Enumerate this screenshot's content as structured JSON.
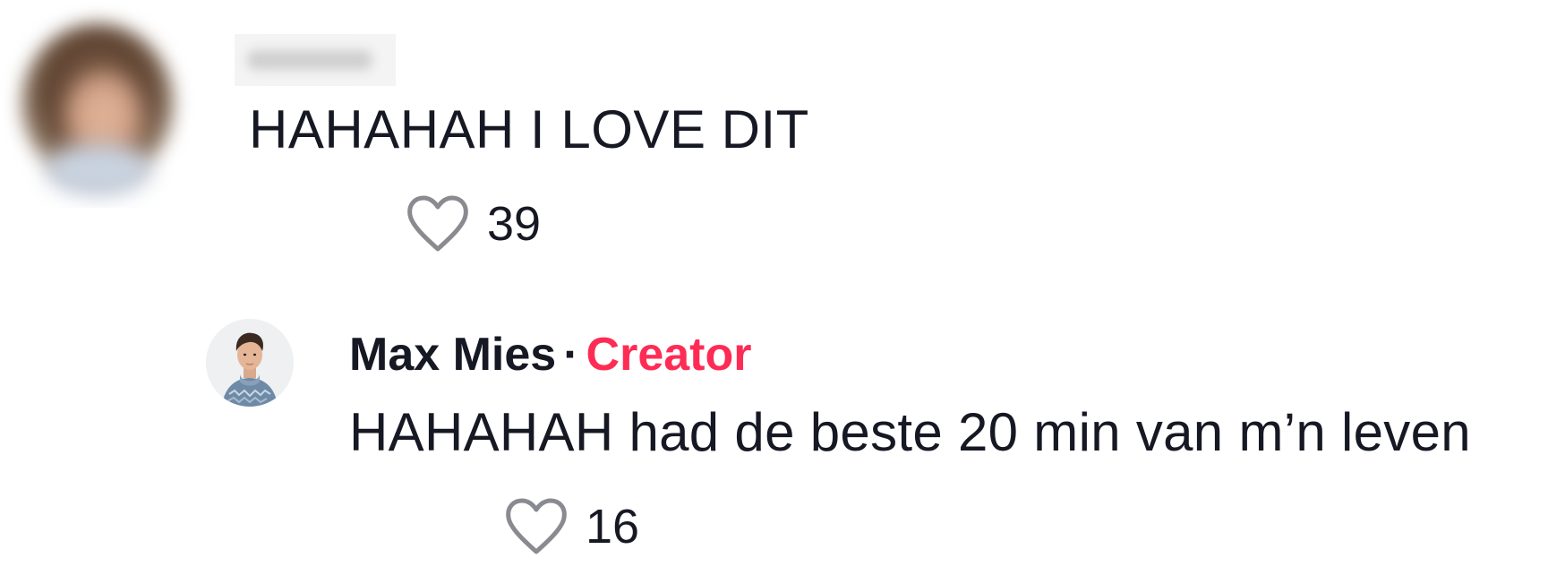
{
  "comment": {
    "text": "HAHAHAH I LOVE DIT",
    "likes": "39"
  },
  "reply": {
    "author": "Max Mies",
    "separator": "·",
    "badge": "Creator",
    "text": "HAHAHAH had de beste 20 min van m’n leven",
    "likes": "16"
  },
  "icons": {
    "like": "heart-icon",
    "avatar": "avatar"
  },
  "colors": {
    "text": "#161823",
    "creator_badge": "#fe2c55",
    "heart_stroke": "#8a8b91"
  }
}
